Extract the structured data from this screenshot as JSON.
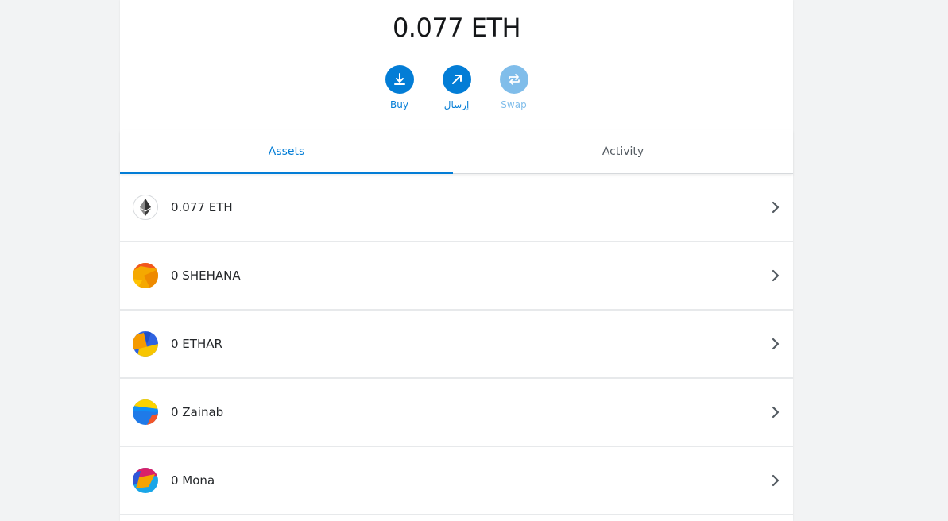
{
  "balance": {
    "amount_text": "0.077 ETH"
  },
  "actions": [
    {
      "label": "Buy",
      "icon": "download-icon",
      "disabled": false
    },
    {
      "label": "إرسال",
      "icon": "arrow-up-right-icon",
      "disabled": false
    },
    {
      "label": "Swap",
      "icon": "swap-icon",
      "disabled": true
    }
  ],
  "tabs": [
    {
      "label": "Assets",
      "active": true
    },
    {
      "label": "Activity",
      "active": false
    }
  ],
  "assets": [
    {
      "text": "0.077 ETH",
      "icon": "ethereum-icon"
    },
    {
      "text": "0 SHEHANA",
      "icon": "token-identicon"
    },
    {
      "text": "0 ETHAR",
      "icon": "token-identicon"
    },
    {
      "text": "0 Zainab",
      "icon": "token-identicon"
    },
    {
      "text": "0 Mona",
      "icon": "token-identicon"
    }
  ],
  "colors": {
    "accent": "#037dd6",
    "text": "#24272a",
    "muted": "#535a61",
    "background": "#f2f3f4"
  }
}
